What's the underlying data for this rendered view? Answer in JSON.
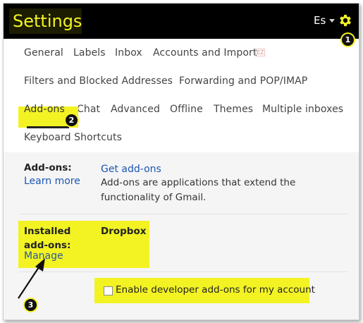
{
  "header": {
    "title": "Settings",
    "language": "Es",
    "gear_icon": "gear-icon",
    "badge1": "1"
  },
  "tabs": {
    "row1": [
      "General",
      "Labels",
      "Inbox",
      "Accounts and Import"
    ],
    "ez_tag": "EZ",
    "row2": [
      "Filters and Blocked Addresses",
      "Forwarding and POP/IMAP"
    ],
    "row3": [
      "Add-ons",
      "Chat",
      "Advanced",
      "Offline",
      "Themes",
      "Multiple inboxes"
    ],
    "row4": [
      "Keyboard Shortcuts"
    ],
    "badge2": "2"
  },
  "addons": {
    "label": "Add-ons:",
    "learn_more": "Learn more",
    "get_addons": "Get add-ons",
    "description": "Add-ons are applications that extend the functionality of Gmail."
  },
  "installed": {
    "label": "Installed add-ons:",
    "manage": "Manage",
    "dropbox": "Dropbox"
  },
  "developer": {
    "checkbox_label": "Enable developer add-ons for my account",
    "checked": false
  },
  "annotation": {
    "badge3": "3"
  },
  "colors": {
    "highlight": "#f3f324",
    "link": "#1a56b5",
    "header_bg": "#000000"
  }
}
